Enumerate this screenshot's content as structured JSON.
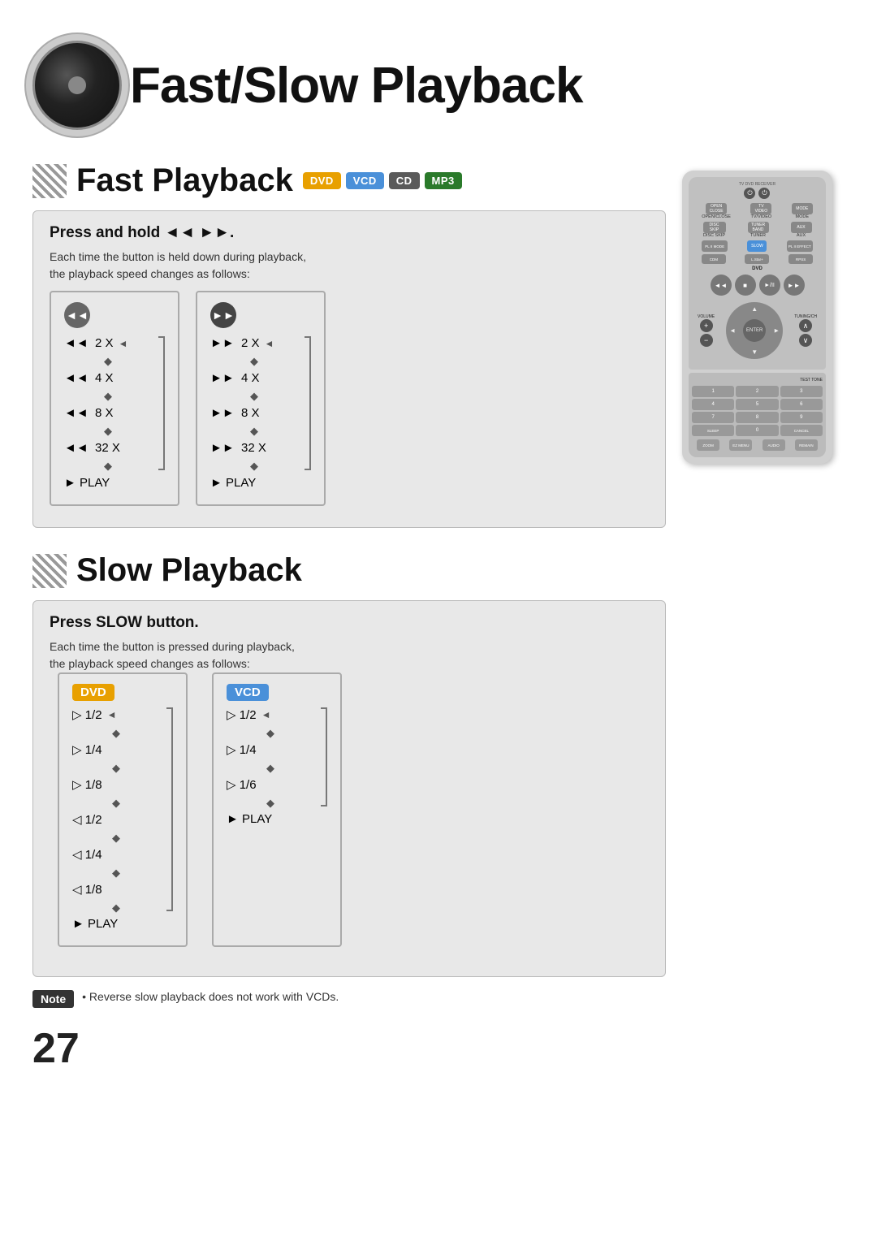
{
  "page": {
    "title": "Fast/Slow Playback",
    "number": "27"
  },
  "fast_playback": {
    "title": "Fast Playback",
    "badges": [
      "DVD",
      "VCD",
      "CD",
      "MP3"
    ],
    "info_title": "Press and hold ◄◄ ►►.",
    "info_text1": "Each time the button is held down during playback,",
    "info_text2": "the playback speed changes as follows:",
    "rewind_steps": [
      "◄◄  2 X",
      "◄◄  4 X",
      "◄◄  8 X",
      "◄◄  32 X",
      "► PLAY"
    ],
    "forward_steps": [
      "►►  2 X",
      "►►  4 X",
      "►►  8 X",
      "►►  32 X",
      "► PLAY"
    ]
  },
  "slow_playback": {
    "title": "Slow Playback",
    "info_title": "Press SLOW button.",
    "info_text1": "Each time the button is pressed during playback,",
    "info_text2": "the playback speed changes as follows:",
    "dvd_label": "DVD",
    "vcd_label": "VCD",
    "dvd_steps": [
      "▷ 1/2",
      "▷ 1/4",
      "▷ 1/8",
      "◁ 1/2",
      "◁ 1/4",
      "◁ 1/8",
      "► PLAY"
    ],
    "vcd_steps": [
      "▷ 1/2",
      "▷ 1/4",
      "▷ 1/6",
      "► PLAY"
    ],
    "note_label": "Note",
    "note_text": "Reverse slow playback does not work with VCDs."
  },
  "remote": {
    "power_label": "⏻",
    "slow_btn": "SLOW",
    "transport_buttons": [
      "◄◄",
      "■",
      "►/II",
      "►►"
    ],
    "nav_up": "▲",
    "nav_down": "▼",
    "nav_left": "◄",
    "nav_right": "►",
    "enter_label": "ENTER",
    "numbers": [
      "1",
      "2",
      "3",
      "4",
      "5",
      "6",
      "7",
      "8",
      "9",
      "SLEEP",
      "0",
      "CANCEL"
    ]
  }
}
